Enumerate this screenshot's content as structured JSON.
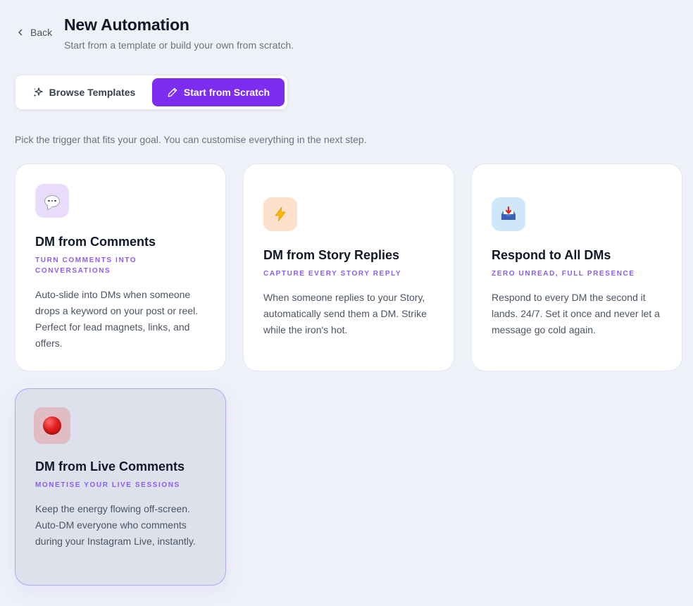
{
  "header": {
    "back_label": "Back",
    "title": "New Automation",
    "subtitle": "Start from a template or build your own from scratch."
  },
  "tabs": {
    "browse_label": "Browse Templates",
    "scratch_label": "Start from Scratch",
    "active": "scratch"
  },
  "hint": "Pick the trigger that fits your goal. You can customise everything in the next step.",
  "colors": {
    "accent": "#7c2df0",
    "tag": "#8b5cf6"
  },
  "cards": [
    {
      "icon": "speech-bubble-icon",
      "title": "DM from Comments",
      "tag": "TURN COMMENTS INTO CONVERSATIONS",
      "description": "Auto-slide into DMs when someone drops a keyword on your post or reel. Perfect for lead magnets, links, and offers.",
      "selected": false
    },
    {
      "icon": "lightning-icon",
      "title": "DM from Story Replies",
      "tag": "CAPTURE EVERY STORY REPLY",
      "description": "When someone replies to your Story, automatically send them a DM. Strike while the iron's hot.",
      "selected": false
    },
    {
      "icon": "inbox-tray-icon",
      "title": "Respond to All DMs",
      "tag": "ZERO UNREAD, FULL PRESENCE",
      "description": "Respond to every DM the second it lands. 24/7. Set it once and never let a message go cold again.",
      "selected": false
    },
    {
      "icon": "red-circle-icon",
      "title": "DM from Live Comments",
      "tag": "MONETISE YOUR LIVE SESSIONS",
      "description": "Keep the energy flowing off-screen. Auto-DM everyone who comments during your Instagram Live, instantly.",
      "selected": true
    }
  ]
}
